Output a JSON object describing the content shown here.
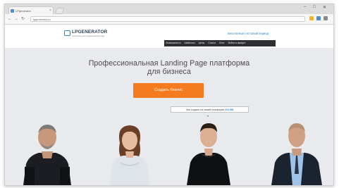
{
  "browser": {
    "tab_title": "LPgenerator",
    "tab_close": "×",
    "address": "lpgenerator.ru",
    "window_controls": [
      "–",
      "□",
      "✕"
    ],
    "nav_icons": [
      "arrow-left-icon",
      "arrow-right-icon",
      "reload-icon"
    ]
  },
  "site": {
    "logo_text": "LPGENERATOR",
    "logo_tagline": "платформа для создания landing page",
    "header_link": "Бесплатный тестовый период",
    "nav": [
      "Возможности",
      "Шаблоны",
      "Цены",
      "Статьи",
      "Блог",
      "Войти в аккаунт"
    ]
  },
  "hero": {
    "title_line1": "Профессиональная Landing Page платформа",
    "title_line2": "для бизнеса",
    "cta_label": "Создать бизнес",
    "badge_text": "Уже создано на нашей платформе ",
    "badge_count": "213 000"
  },
  "colors": {
    "accent": "#f47b20",
    "brand": "#2c82c9",
    "nav_bg": "#2d2f33",
    "page_bg": "#e9eaee"
  }
}
